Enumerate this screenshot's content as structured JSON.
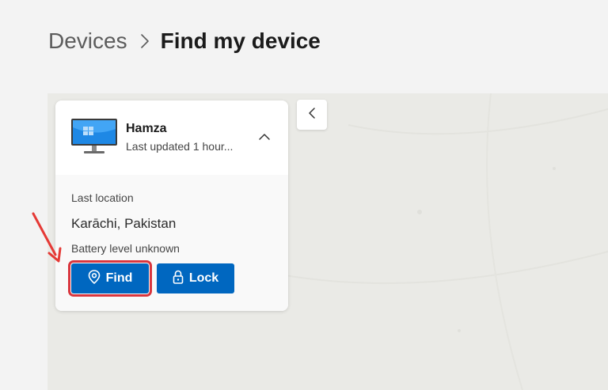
{
  "breadcrumb": {
    "parent": "Devices",
    "current": "Find my device"
  },
  "device": {
    "name": "Hamza",
    "updated": "Last updated 1 hour..."
  },
  "location": {
    "label": "Last location",
    "value": "Karāchi, Pakistan"
  },
  "battery": {
    "text": "Battery level unknown"
  },
  "actions": {
    "find_label": "Find",
    "lock_label": "Lock"
  },
  "icons": {
    "chevron_separator": "chevron-right-icon",
    "collapse": "chevron-left-icon",
    "expand": "chevron-up-icon",
    "device": "desktop-monitor-icon",
    "find": "location-pin-icon",
    "lock": "lock-icon"
  },
  "colors": {
    "accent": "#0067c0",
    "highlight": "#d9363e",
    "background": "#f3f3f3",
    "map": "#eaeae6"
  }
}
